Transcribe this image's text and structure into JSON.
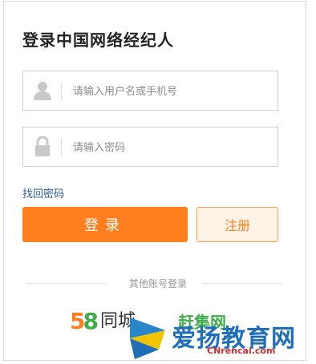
{
  "login": {
    "title": "登录中国网络经纪人",
    "username_placeholder": "请输入用户名或手机号",
    "password_placeholder": "请输入密码",
    "forgot_label": "找回密码",
    "login_label": "登录",
    "register_label": "注册",
    "other_login_label": "其他账号登录"
  },
  "third_party": {
    "tongcheng_five": "5",
    "tongcheng_eight": "8",
    "tongcheng_name": "同城",
    "ganji_label": "赶集网"
  },
  "watermark": {
    "text": "爱扬教育网",
    "sub": "CNrencai.com"
  },
  "icons": {
    "user": "user-icon",
    "lock": "lock-icon"
  },
  "colors": {
    "accent": "#ff7f1f",
    "link": "#2a5b9c",
    "green": "#3fae49",
    "watermark_blue": "#1f6fb8"
  }
}
